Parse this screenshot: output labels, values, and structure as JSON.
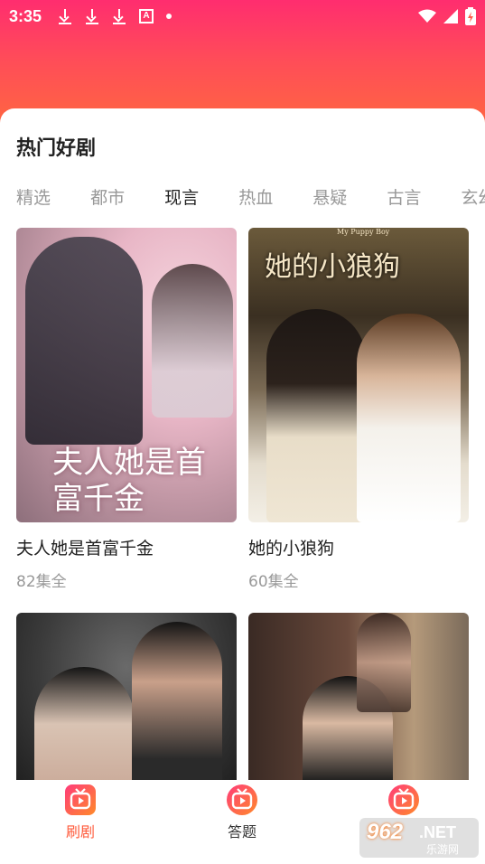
{
  "status_bar": {
    "time": "3:35"
  },
  "section": {
    "title": "热门好剧"
  },
  "tabs": [
    "精选",
    "都市",
    "现言",
    "热血",
    "悬疑",
    "古言",
    "玄幻"
  ],
  "active_tab_index": 2,
  "dramas": [
    {
      "title": "夫人她是首富千金",
      "episodes": "82集全",
      "poster_text": "夫人她是首富千金"
    },
    {
      "title": "她的小狼狗",
      "episodes": "60集全",
      "poster_text": "她的小狼狗",
      "poster_text_en": "My Puppy Boy"
    },
    {
      "title": "",
      "episodes": ""
    },
    {
      "title": "",
      "episodes": ""
    }
  ],
  "bottom_nav": [
    {
      "label": "刷剧",
      "icon": "tv-play-icon",
      "active": true
    },
    {
      "label": "答题",
      "icon": "tv-play-icon",
      "active": false
    },
    {
      "label": "",
      "icon": "tv-play-icon",
      "active": false
    }
  ],
  "watermark": {
    "number": "962",
    "suffix": ".NET",
    "sub": "乐游网"
  },
  "colors": {
    "accent": "#ff5a3a",
    "header_top": "#ff2d6f",
    "header_bottom": "#ff6a3d"
  }
}
